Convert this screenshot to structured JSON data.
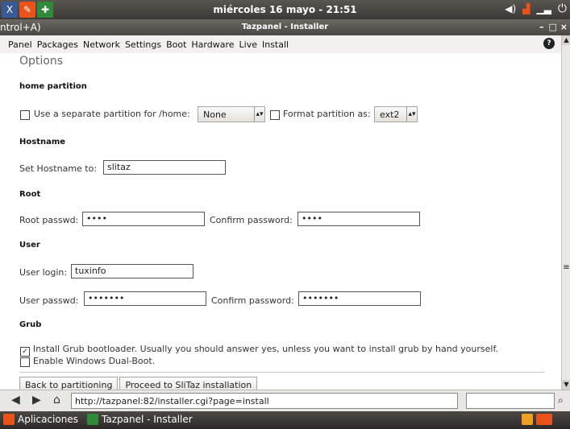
{
  "top_panel": {
    "clock": "miércoles 16 mayo - 21:51",
    "apps": [
      "x-terminal-icon",
      "tools-icon",
      "tazpanel-icon"
    ],
    "accent": "#e9531a"
  },
  "window": {
    "hint_text": "ntrol+A)",
    "title": "Tazpanel - Installer",
    "minimize": "–",
    "close": "□ ×"
  },
  "menubar": {
    "items": [
      "Panel",
      "Packages",
      "Network",
      "Settings",
      "Boot",
      "Hardware",
      "Live",
      "Install"
    ]
  },
  "page": {
    "options_heading": "Options",
    "home_partition": {
      "heading": "home partition",
      "separate_label": "Use a separate partition for /home:",
      "partition_value": "None",
      "format_label": "Format partition as:",
      "format_value": "ext2"
    },
    "hostname": {
      "heading": "Hostname",
      "label": "Set Hostname to:",
      "value": "slitaz"
    },
    "root": {
      "heading": "Root",
      "passwd_label": "Root passwd:",
      "passwd_value": "••••",
      "confirm_label": "Confirm password:",
      "confirm_value": "••••"
    },
    "user": {
      "heading": "User",
      "login_label": "User login:",
      "login_value": "tuxinfo",
      "passwd_label": "User passwd:",
      "passwd_value": "•••••••",
      "confirm_label": "Confirm password:",
      "confirm_value": "•••••••"
    },
    "grub": {
      "heading": "Grub",
      "install_label": "Install Grub bootloader. Usually you should answer yes, unless you want to install grub by hand yourself.",
      "install_checked": "✓",
      "dualboot_label": "Enable Windows Dual-Boot."
    },
    "buttons": {
      "back": "Back to partitioning",
      "proceed": "Proceed to SliTaz installation"
    }
  },
  "address_bar": {
    "url": "http://tazpanel:82/installer.cgi?page=install",
    "search_placeholder": ""
  },
  "taskbar": {
    "menu_label": "Aplicaciones",
    "task_label": "Tazpanel - Installer"
  }
}
